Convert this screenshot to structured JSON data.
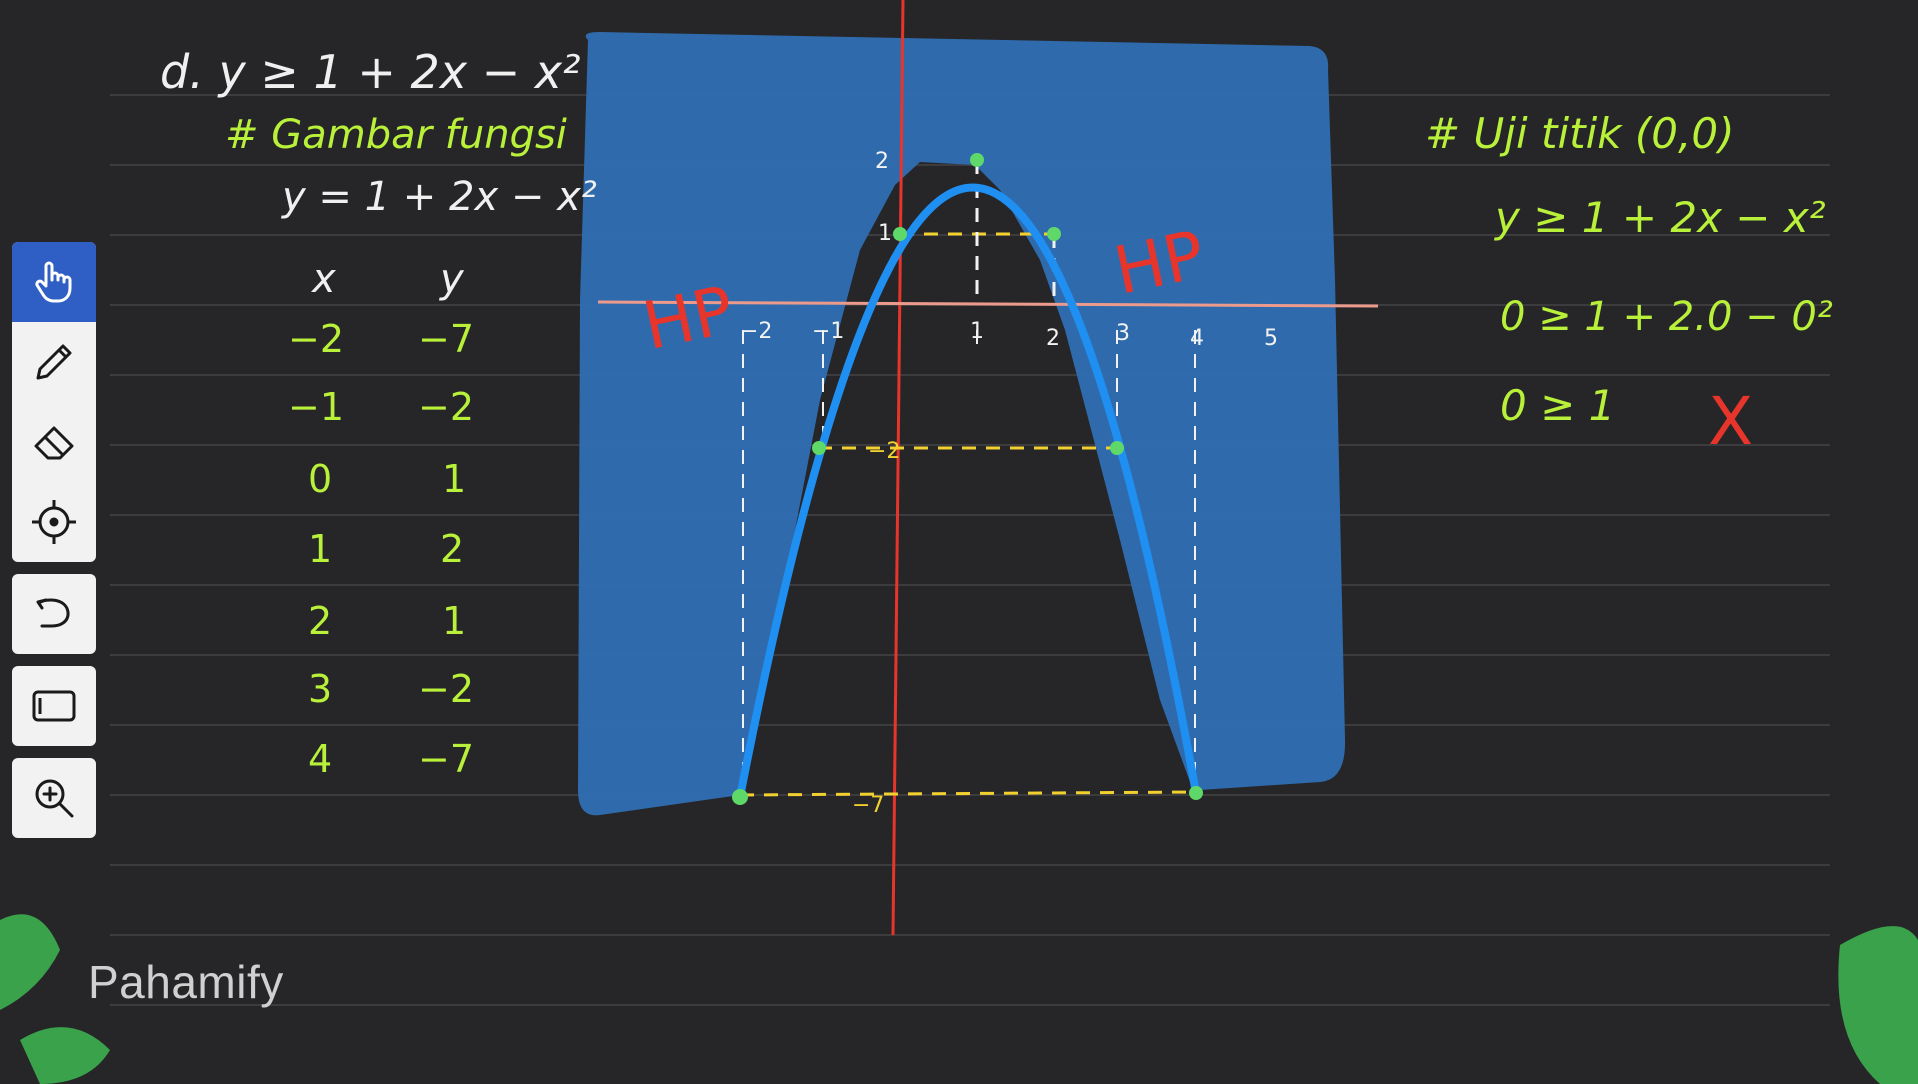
{
  "brand": {
    "logo_text": "Pahamify"
  },
  "toolbar": {
    "tools": [
      {
        "name": "hand-tool",
        "icon": "hand-pointer-icon",
        "active": true
      },
      {
        "name": "pen-tool",
        "icon": "pencil-icon",
        "active": false
      },
      {
        "name": "eraser-tool",
        "icon": "eraser-icon",
        "active": false
      },
      {
        "name": "laser-tool",
        "icon": "crosshair-icon",
        "active": false
      },
      {
        "name": "undo-button",
        "icon": "undo-icon",
        "active": false
      },
      {
        "name": "shape-tool",
        "icon": "rectangle-icon",
        "active": false
      },
      {
        "name": "zoom-button",
        "icon": "zoom-in-icon",
        "active": false
      }
    ]
  },
  "left_notes": {
    "problem": "d.  y ≥ 1 + 2x − x²",
    "heading": "# Gambar fungsi",
    "function": "y = 1 + 2x − x²",
    "table_header": {
      "x": "x",
      "y": "y"
    },
    "table_rows": [
      {
        "x": "−2",
        "y": "−7"
      },
      {
        "x": "−1",
        "y": "−2"
      },
      {
        "x": "0",
        "y": "1"
      },
      {
        "x": "1",
        "y": "2"
      },
      {
        "x": "2",
        "y": "1"
      },
      {
        "x": "3",
        "y": "−2"
      },
      {
        "x": "4",
        "y": "−7"
      }
    ]
  },
  "graph": {
    "region_label_left": "HP",
    "region_label_right": "HP",
    "x_ticks": [
      "−2",
      "−1",
      "1",
      "2",
      "3",
      "4",
      "5"
    ],
    "y_ticks": [
      "2",
      "1",
      "−2",
      "−7"
    ],
    "points": [
      {
        "x": -2,
        "y": -7
      },
      {
        "x": -1,
        "y": -2
      },
      {
        "x": 0,
        "y": 1
      },
      {
        "x": 1,
        "y": 2
      },
      {
        "x": 2,
        "y": 1
      },
      {
        "x": 3,
        "y": -2
      },
      {
        "x": 4,
        "y": -7
      }
    ]
  },
  "right_notes": {
    "heading": "# Uji titik (0,0)",
    "line1": "y ≥ 1 + 2x − x²",
    "line2": "0 ≥ 1 + 2.0 − 0²",
    "line3": "0 ≥ 1",
    "mark": "X"
  },
  "colors": {
    "background": "#262628",
    "ink_green": "#b8f03a",
    "ink_white": "#f0f0f0",
    "shade_blue": "#2f6fb3",
    "curve_blue": "#1f8ff2",
    "axis_red": "#e8352c",
    "point_green": "#5fd86a",
    "dash_yellow": "#f2d030",
    "cross_red": "#e8352c"
  }
}
